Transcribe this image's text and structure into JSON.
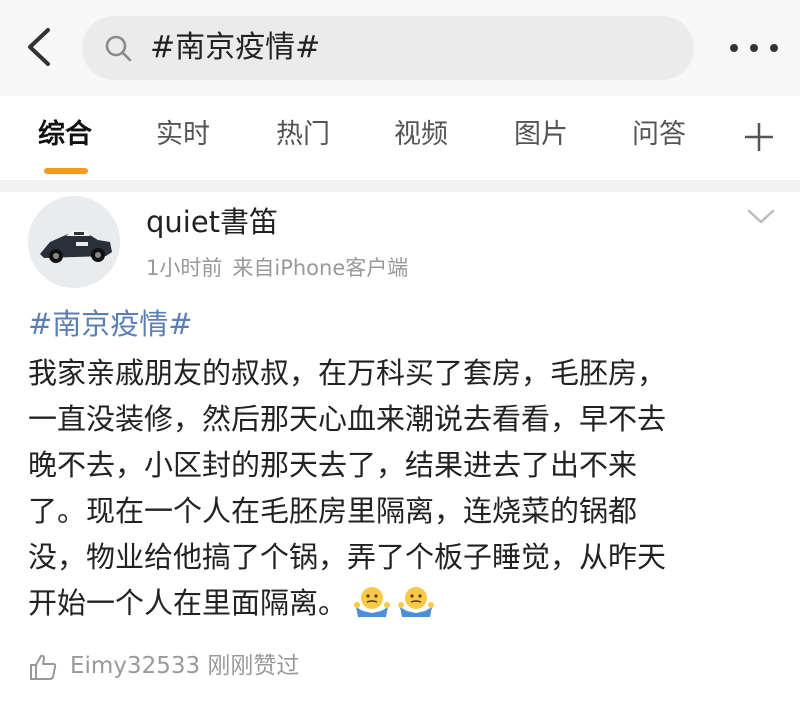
{
  "search": {
    "query": "#南京疫情#"
  },
  "tabs": [
    "综合",
    "实时",
    "热门",
    "视频",
    "图片",
    "问答"
  ],
  "post": {
    "author": "quiet書笛",
    "time": "1小时前",
    "source": "来自iPhone客户端",
    "hashtag": "#南京疫情#",
    "lines": [
      "我家亲戚朋友的叔叔，在万科买了套房，毛胚房，",
      "一直没装修，然后那天心血来潮说去看看，早不去",
      "晚不去，小区封的那天去了，结果进去了出不来",
      "了。现在一个人在毛胚房里隔离，连烧菜的锅都",
      "没，物业给他搞了个锅，弄了个板子睡觉，从昨天",
      "开始一个人在里面隔离。"
    ],
    "emoji_icon": "shrug-emoji",
    "like_text": "Eimy32533 刚刚赞过"
  },
  "colors": {
    "accent": "#f29b1d",
    "hashtag": "#5b7fb3",
    "muted": "#999999"
  }
}
